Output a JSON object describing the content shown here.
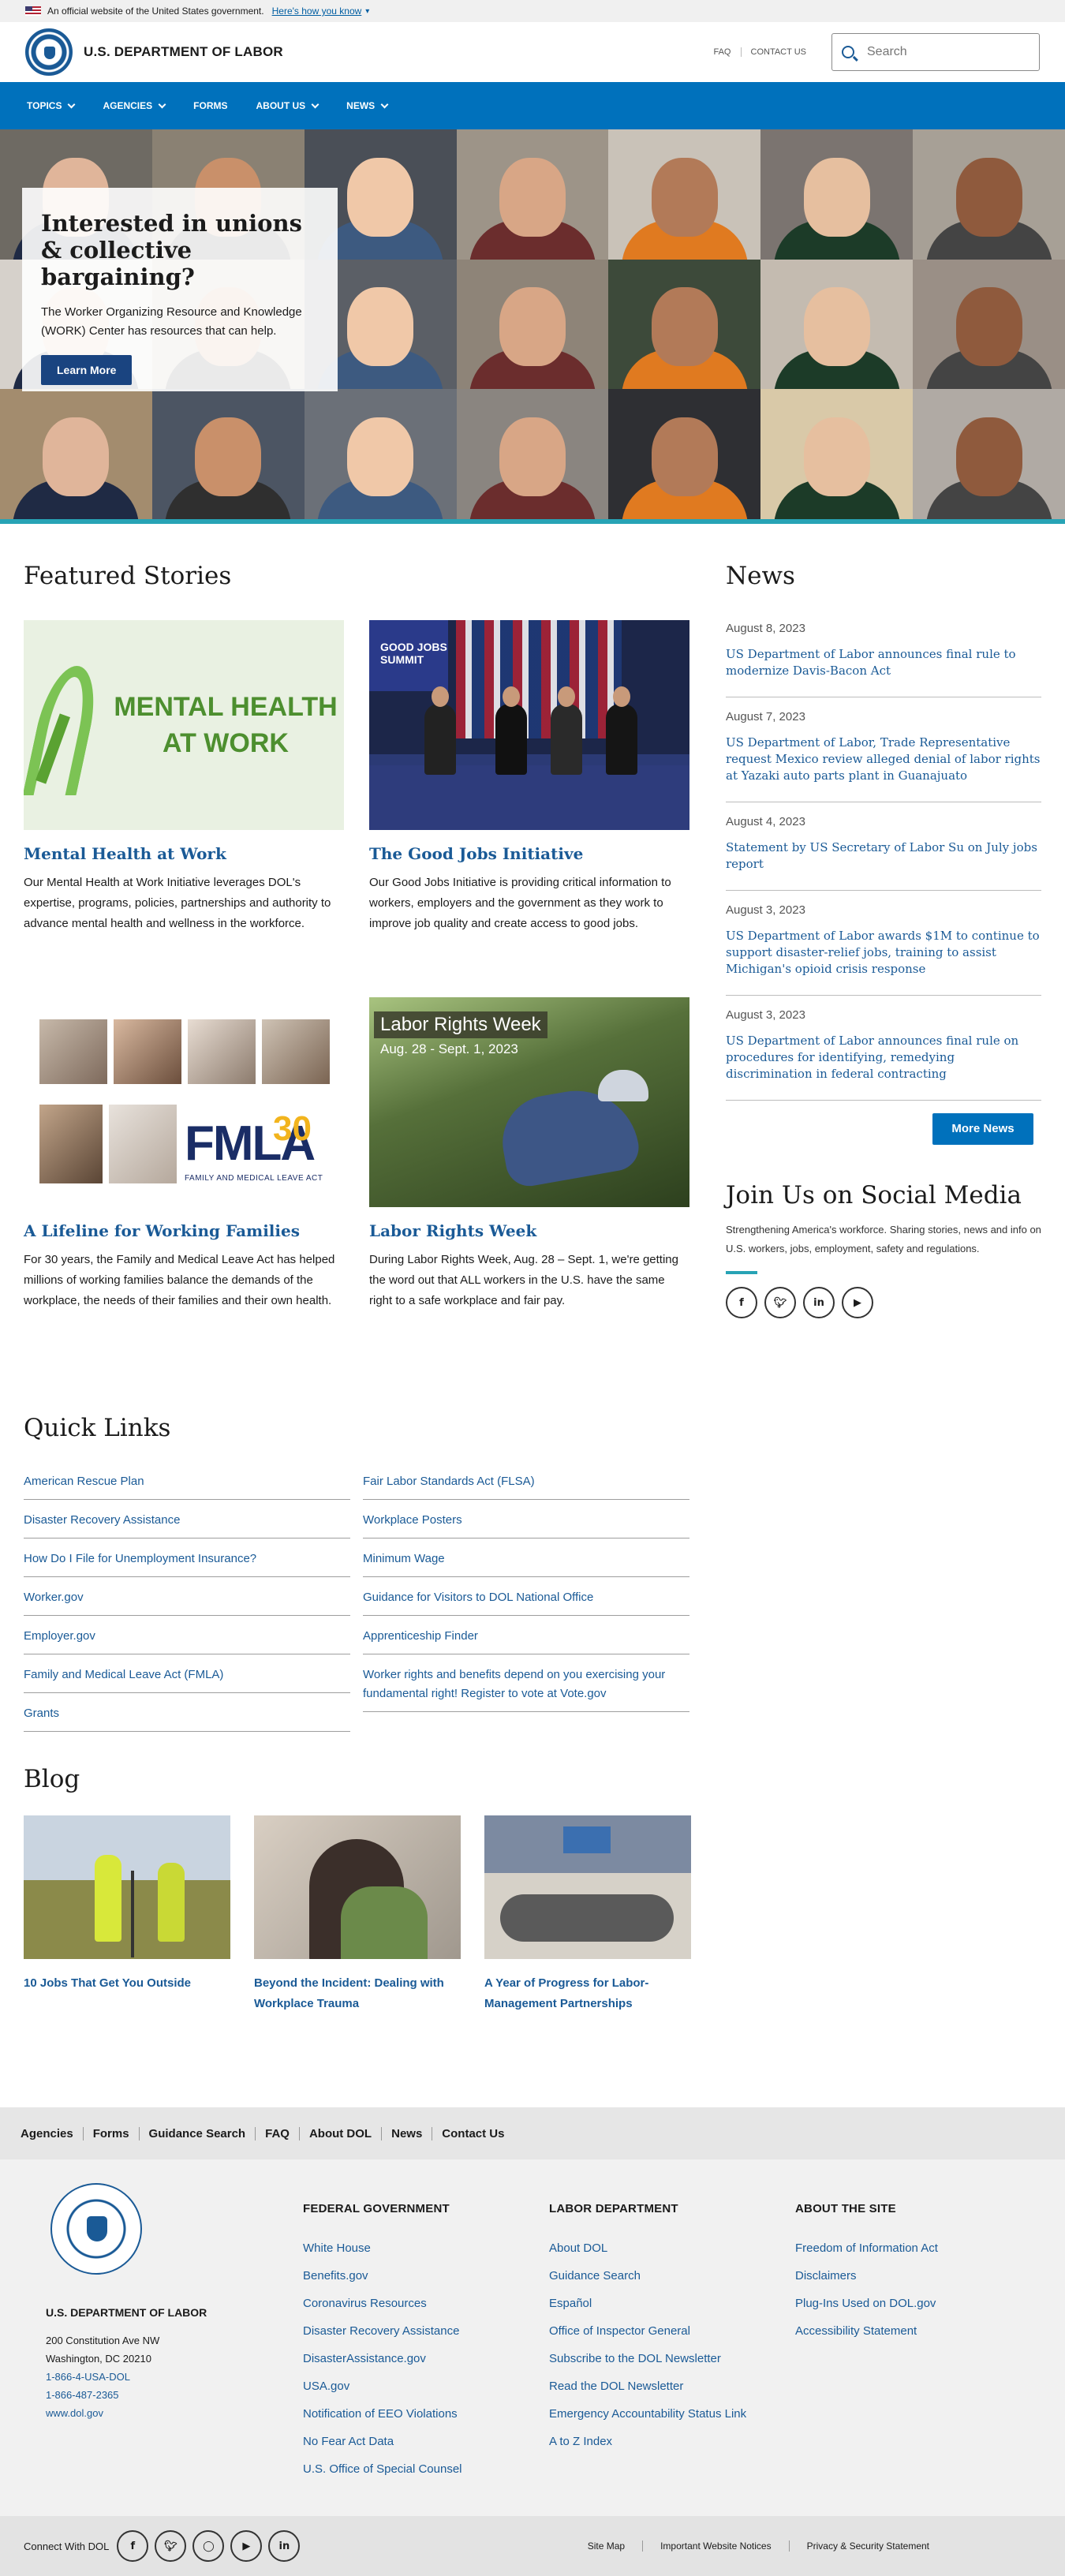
{
  "gov_banner": {
    "text": "An official website of the United States government.",
    "link": "Here's how you know"
  },
  "header": {
    "title": "U.S. DEPARTMENT OF LABOR",
    "faq": "FAQ",
    "contact": "CONTACT US",
    "search_placeholder": "Search"
  },
  "nav": [
    "TOPICS",
    "AGENCIES",
    "FORMS",
    "ABOUT US",
    "NEWS"
  ],
  "hero": {
    "title": "Interested in unions & collective bargaining?",
    "text": "The Worker Organizing Resource and Knowledge (WORK) Center has resources that can help.",
    "button": "Learn More"
  },
  "featured": {
    "title": "Featured Stories",
    "stories": [
      {
        "title": "Mental Health at Work",
        "text": "Our Mental Health at Work Initiative leverages DOL's expertise, programs, policies, partnerships and authority to advance mental health and wellness in the workforce.",
        "image_text": [
          "MENTAL HEALTH",
          "AT WORK"
        ]
      },
      {
        "title": "The Good Jobs Initiative",
        "text": "Our Good Jobs Initiative is providing critical information to workers, employers and the government as they work to improve job quality and create access to good jobs.",
        "image_text": "GOOD JOBS SUMMIT"
      },
      {
        "title": "A Lifeline for Working Families",
        "text": "For 30 years, the Family and Medical Leave Act has helped millions of working families balance the demands of the workplace, the needs of their families and their own health.",
        "image_text": {
          "logo": "FMLA",
          "years": "30",
          "sub": "FAMILY AND MEDICAL LEAVE ACT"
        }
      },
      {
        "title": "Labor Rights Week",
        "text": "During Labor Rights Week, Aug. 28 – Sept. 1, we're getting the word out that ALL workers in the U.S. have the same right to a safe workplace and fair pay.",
        "image_text": {
          "title": "Labor Rights Week",
          "date": "Aug. 28 - Sept. 1, 2023"
        }
      }
    ]
  },
  "news": {
    "title": "News",
    "items": [
      {
        "date": "August 8, 2023",
        "headline": "US Department of Labor announces final rule to modernize Davis-Bacon Act"
      },
      {
        "date": "August 7, 2023",
        "headline": "US Department of Labor, Trade Representative request Mexico review alleged denial of labor rights at Yazaki auto parts plant in Guanajuato"
      },
      {
        "date": "August 4, 2023",
        "headline": "Statement by US Secretary of Labor Su on July jobs report"
      },
      {
        "date": "August 3, 2023",
        "headline": "US Department of Labor awards $1M to continue to support disaster-relief jobs, training to assist Michigan's opioid crisis response"
      },
      {
        "date": "August 3, 2023",
        "headline": "US Department of Labor announces final rule on procedures for identifying, remedying discrimination in federal contracting"
      }
    ],
    "more": "More News"
  },
  "social": {
    "title": "Join Us on Social Media",
    "text": "Strengthening America's workforce. Sharing stories, news and info on U.S. workers, jobs, employment, safety and regulations.",
    "icons": [
      "facebook-icon",
      "twitter-icon",
      "linkedin-icon",
      "youtube-icon"
    ]
  },
  "quick_links": {
    "title": "Quick Links",
    "left": [
      "American Rescue Plan",
      "Disaster Recovery Assistance",
      "How Do I File for Unemployment Insurance?",
      "Worker.gov",
      "Employer.gov",
      "Family and Medical Leave Act (FMLA)",
      "Grants"
    ],
    "right": [
      "Fair Labor Standards Act (FLSA)",
      "Workplace Posters",
      "Minimum Wage",
      "Guidance for Visitors to DOL National Office",
      "Apprenticeship Finder",
      "Worker rights and benefits depend on you exercising your fundamental right! Register to vote at Vote.gov"
    ]
  },
  "blog": {
    "title": "Blog",
    "posts": [
      "10 Jobs That Get You Outside",
      "Beyond the Incident: Dealing with Workplace Trauma",
      "A Year of Progress for Labor-Management Partnerships"
    ]
  },
  "footer_nav": [
    "Agencies",
    "Forms",
    "Guidance Search",
    "FAQ",
    "About DOL",
    "News",
    "Contact Us"
  ],
  "footer": {
    "org": "U.S. DEPARTMENT OF LABOR",
    "address1": "200 Constitution Ave NW",
    "address2": "Washington, DC 20210",
    "phone1": "1-866-4-USA-DOL",
    "phone2": "1-866-487-2365",
    "site": "www.dol.gov",
    "columns": [
      {
        "title": "FEDERAL GOVERNMENT",
        "links": [
          "White House",
          "Benefits.gov",
          "Coronavirus Resources",
          "Disaster Recovery Assistance",
          "DisasterAssistance.gov",
          "USA.gov",
          "Notification of EEO Violations",
          "No Fear Act Data",
          "U.S. Office of Special Counsel"
        ]
      },
      {
        "title": "LABOR DEPARTMENT",
        "links": [
          "About DOL",
          "Guidance Search",
          "Español",
          "Office of Inspector General",
          "Subscribe to the DOL Newsletter",
          "Read the DOL Newsletter",
          "Emergency Accountability Status Link",
          "A to Z Index"
        ]
      },
      {
        "title": "ABOUT THE SITE",
        "links": [
          "Freedom of Information Act",
          "Disclaimers",
          "Plug-Ins Used on DOL.gov",
          "Accessibility Statement"
        ]
      }
    ]
  },
  "footer_bottom": {
    "connect": "Connect With DOL",
    "icons": [
      "facebook-icon",
      "twitter-icon",
      "instagram-icon",
      "youtube-icon",
      "linkedin-icon"
    ],
    "legal": [
      "Site Map",
      "Important Website Notices",
      "Privacy & Security Statement"
    ]
  },
  "colors": {
    "brand_blue": "#0071bc",
    "link_blue": "#1a5a96",
    "accent_teal": "#27a3b5",
    "button_navy": "#1a4480"
  }
}
